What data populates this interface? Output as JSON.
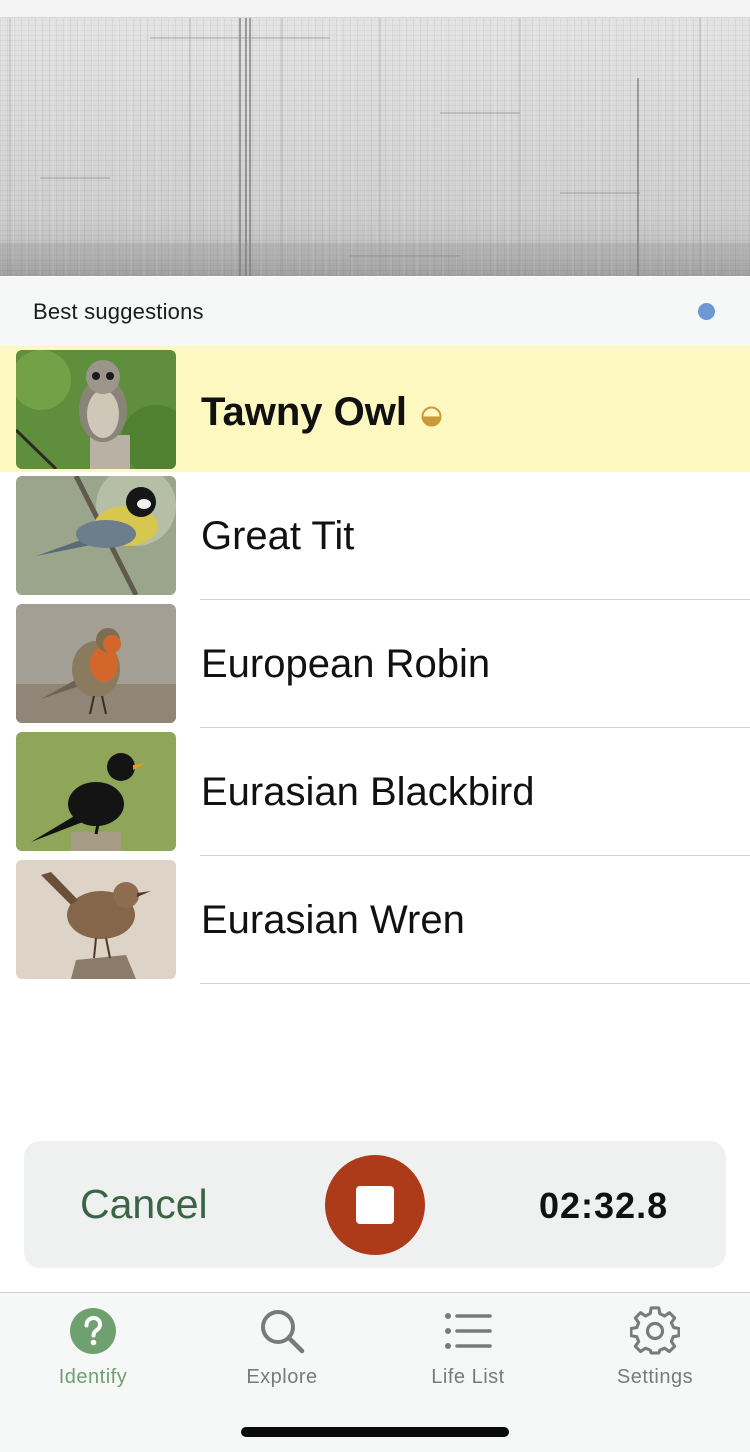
{
  "spectrogram": {
    "icon": "audio-spectrogram"
  },
  "suggestions": {
    "title": "Best suggestions",
    "status_color": "#6e97d6",
    "items": [
      {
        "name": "Tawny Owl",
        "highlighted": true,
        "badge_icon": "half-circle-icon",
        "badge_color": "#c99a3a"
      },
      {
        "name": "Great Tit",
        "highlighted": false
      },
      {
        "name": "European Robin",
        "highlighted": false
      },
      {
        "name": "Eurasian Blackbird",
        "highlighted": false
      },
      {
        "name": "Eurasian Wren",
        "highlighted": false
      }
    ]
  },
  "recorder": {
    "cancel_label": "Cancel",
    "timer": "02:32.8",
    "stop_icon": "stop-icon",
    "stop_color": "#ad3b1a"
  },
  "tabs": [
    {
      "label": "Identify",
      "icon": "question-circle-icon",
      "active": true,
      "active_color": "#6fa06f"
    },
    {
      "label": "Explore",
      "icon": "search-icon",
      "active": false
    },
    {
      "label": "Life List",
      "icon": "list-icon",
      "active": false
    },
    {
      "label": "Settings",
      "icon": "gear-icon",
      "active": false
    }
  ]
}
